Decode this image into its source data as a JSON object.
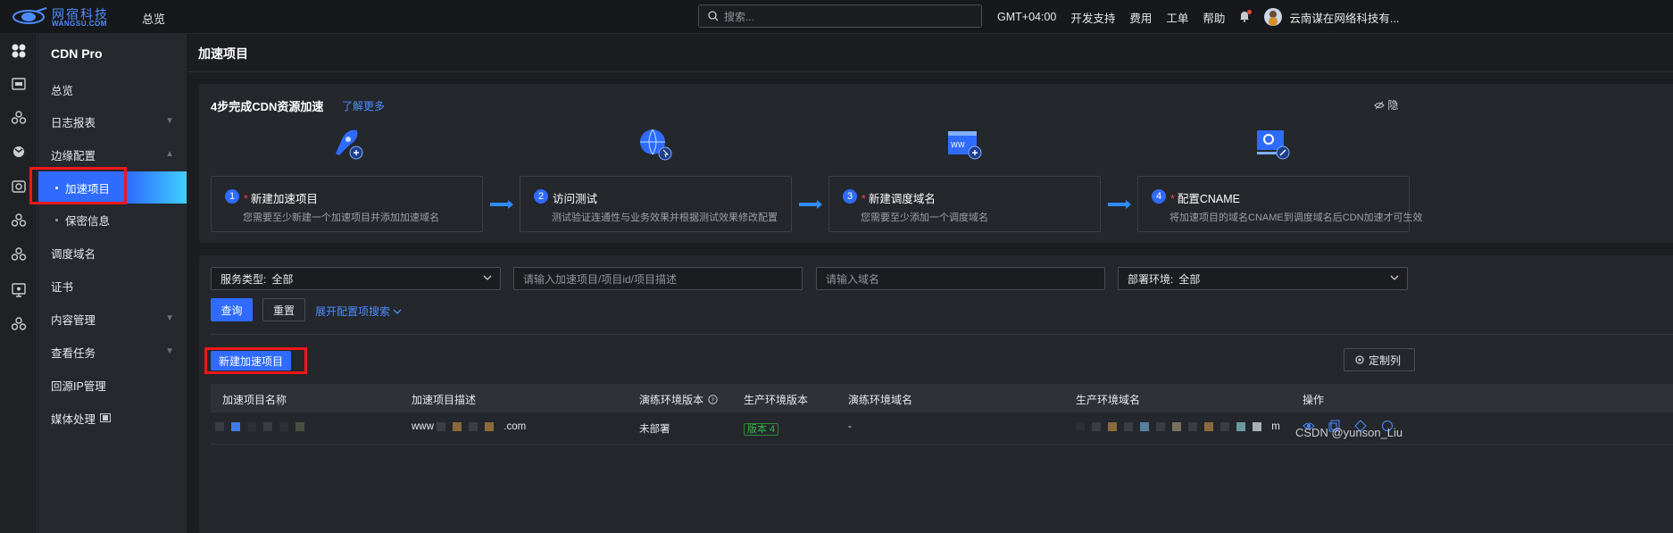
{
  "topbar": {
    "logo_cn": "网宿科技",
    "logo_en": "WANGSU.COM",
    "overview": "总览",
    "search_placeholder": "搜索...",
    "timezone": "GMT+04:00",
    "dev_support": "开发支持",
    "billing": "费用",
    "tickets": "工单",
    "help": "帮助",
    "user": "云南谋在网络科技有..."
  },
  "nav": {
    "product": "CDN Pro",
    "items": [
      {
        "label": "总览"
      },
      {
        "label": "日志报表"
      },
      {
        "label": "边缘配置"
      },
      {
        "label": "加速项目"
      },
      {
        "label": "保密信息"
      },
      {
        "label": "调度域名"
      },
      {
        "label": "证书"
      },
      {
        "label": "内容管理"
      },
      {
        "label": "查看任务"
      },
      {
        "label": "回源IP管理"
      },
      {
        "label": "媒体处理"
      }
    ]
  },
  "page": {
    "title": "加速项目"
  },
  "steps": {
    "title": "4步完成CDN资源加速",
    "learn_more": "了解更多",
    "hide": "隐",
    "items": [
      {
        "num": "1",
        "required": "*",
        "title": "新建加速项目",
        "desc": "您需要至少新建一个加速项目并添加加速域名"
      },
      {
        "num": "2",
        "required": "",
        "title": "访问测试",
        "desc": "测试验证连通性与业务效果并根据测试效果修改配置"
      },
      {
        "num": "3",
        "required": "*",
        "title": "新建调度域名",
        "desc": "您需要至少添加一个调度域名"
      },
      {
        "num": "4",
        "required": "*",
        "title": "配置CNAME",
        "desc": "将加速项目的域名CNAME到调度域名后CDN加速才可生效"
      }
    ]
  },
  "filters": {
    "service_type_label": "服务类型:",
    "service_type_value": "全部",
    "project_placeholder": "请输入加速项目/项目id/项目描述",
    "domain_placeholder": "请输入域名",
    "env_label": "部署环境:",
    "env_value": "全部",
    "query": "查询",
    "reset": "重置",
    "expand": "展开配置项搜索"
  },
  "actions": {
    "new_project": "新建加速项目",
    "custom_columns": "定制列"
  },
  "table": {
    "columns": [
      "加速项目名称",
      "加速项目描述",
      "演练环境版本",
      "生产环境版本",
      "演练环境域名",
      "生产环境域名",
      "操作"
    ],
    "rows": [
      {
        "name": "",
        "desc_prefix": "www",
        "desc_suffix": ".com",
        "staging_version": "未部署",
        "prod_version": "版本 4",
        "staging_domain": "-",
        "prod_domain_suffix": "m"
      }
    ]
  },
  "watermark": "CSDN @yunson_Liu"
}
